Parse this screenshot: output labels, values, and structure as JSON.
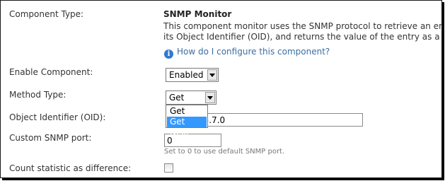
{
  "component": {
    "type_label": "Component Type:",
    "type_value": "SNMP Monitor",
    "description_line1": "This component monitor uses the SNMP protocol to retrieve an entry in a",
    "description_line2": "its Object Identifier (OID), and returns the value of the entry as a statistic.",
    "help_link": "How do I configure this component?"
  },
  "enable": {
    "label": "Enable Component:",
    "selected": "Enabled"
  },
  "method": {
    "label": "Method Type:",
    "selected": "Get",
    "options": [
      "Get",
      "Get Next"
    ],
    "highlighted_option": "Get Next"
  },
  "oid": {
    "label": "Object Identifier (OID):",
    "value": "9.156.1.5.7.0"
  },
  "port": {
    "label": "Custom SNMP port:",
    "value": "0",
    "hint": "Set to 0 to use default SNMP port."
  },
  "count": {
    "label": "Count statistic as difference:",
    "checked": false
  },
  "colors": {
    "link": "#3a6ea5",
    "highlight": "#3399ff",
    "info_icon": "#2f7ad0"
  },
  "icons": {
    "info": "info-icon",
    "dropdown": "chevron-down-icon"
  }
}
